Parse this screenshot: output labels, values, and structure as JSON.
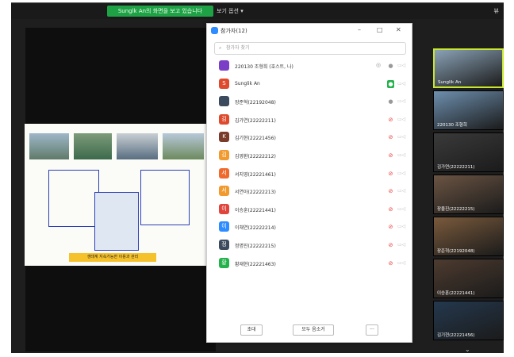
{
  "topbar": {
    "share_banner": "Sunglk An의 화면을 보고 있습니다",
    "view_options": "보기 옵션 ▾",
    "corner_label": "뷰"
  },
  "slide": {
    "bottom_caption": "생태계 지속가능한 이용과 관리"
  },
  "panel": {
    "title": "참가자(12)",
    "search_placeholder": "참가자 찾기",
    "participants": [
      {
        "initial": "",
        "name": "220130 조형희 (호스트, 나)",
        "color": "#7b3fc7",
        "mic": "on",
        "extra": "◎"
      },
      {
        "initial": "S",
        "name": "Sunglik An",
        "color": "#e04a2c",
        "mic": "active",
        "extra": ""
      },
      {
        "initial": "",
        "name": "장준혁(22192048)",
        "color": "#3b4a5c",
        "mic": "on",
        "extra": ""
      },
      {
        "initial": "김",
        "name": "김가연(22222211)",
        "color": "#e04a2c",
        "mic": "muted",
        "extra": ""
      },
      {
        "initial": "K",
        "name": "김기현(22221456)",
        "color": "#7a3b2b",
        "mic": "muted",
        "extra": ""
      },
      {
        "initial": "김",
        "name": "김영환(22222212)",
        "color": "#f29a2e",
        "mic": "muted",
        "extra": ""
      },
      {
        "initial": "서",
        "name": "서지영(22221461)",
        "color": "#f06a2c",
        "mic": "muted",
        "extra": ""
      },
      {
        "initial": "서",
        "name": "서연아(22222213)",
        "color": "#f29a2e",
        "mic": "muted",
        "extra": ""
      },
      {
        "initial": "이",
        "name": "이승훈(22221441)",
        "color": "#e0443c",
        "mic": "muted",
        "extra": ""
      },
      {
        "initial": "이",
        "name": "이채연(22222214)",
        "color": "#2d8cff",
        "mic": "muted",
        "extra": ""
      },
      {
        "initial": "정",
        "name": "정명진(22222215)",
        "color": "#3b4a5c",
        "mic": "muted",
        "extra": ""
      },
      {
        "initial": "황",
        "name": "황재현(22221463)",
        "color": "#23b24b",
        "mic": "muted",
        "extra": ""
      }
    ],
    "invite_label": "초대",
    "mute_all_label": "모두 음소거",
    "more_label": "···"
  },
  "gallery": [
    {
      "name": "Sunglik An",
      "bg": "#8aa2b6",
      "active": true
    },
    {
      "name": "220130 조형희",
      "bg": "#6d8fae",
      "active": false
    },
    {
      "name": "김가연(22222211)",
      "bg": "#3a3a3a",
      "active": false
    },
    {
      "name": "장율진(22222215)",
      "bg": "#6b5443",
      "active": false
    },
    {
      "name": "장준혁(22192048)",
      "bg": "#7a5a3c",
      "active": false
    },
    {
      "name": "이승훈(22221441)",
      "bg": "#4d3b2f",
      "active": false
    },
    {
      "name": "김기현(22221456)",
      "bg": "#24384e",
      "active": false
    }
  ]
}
